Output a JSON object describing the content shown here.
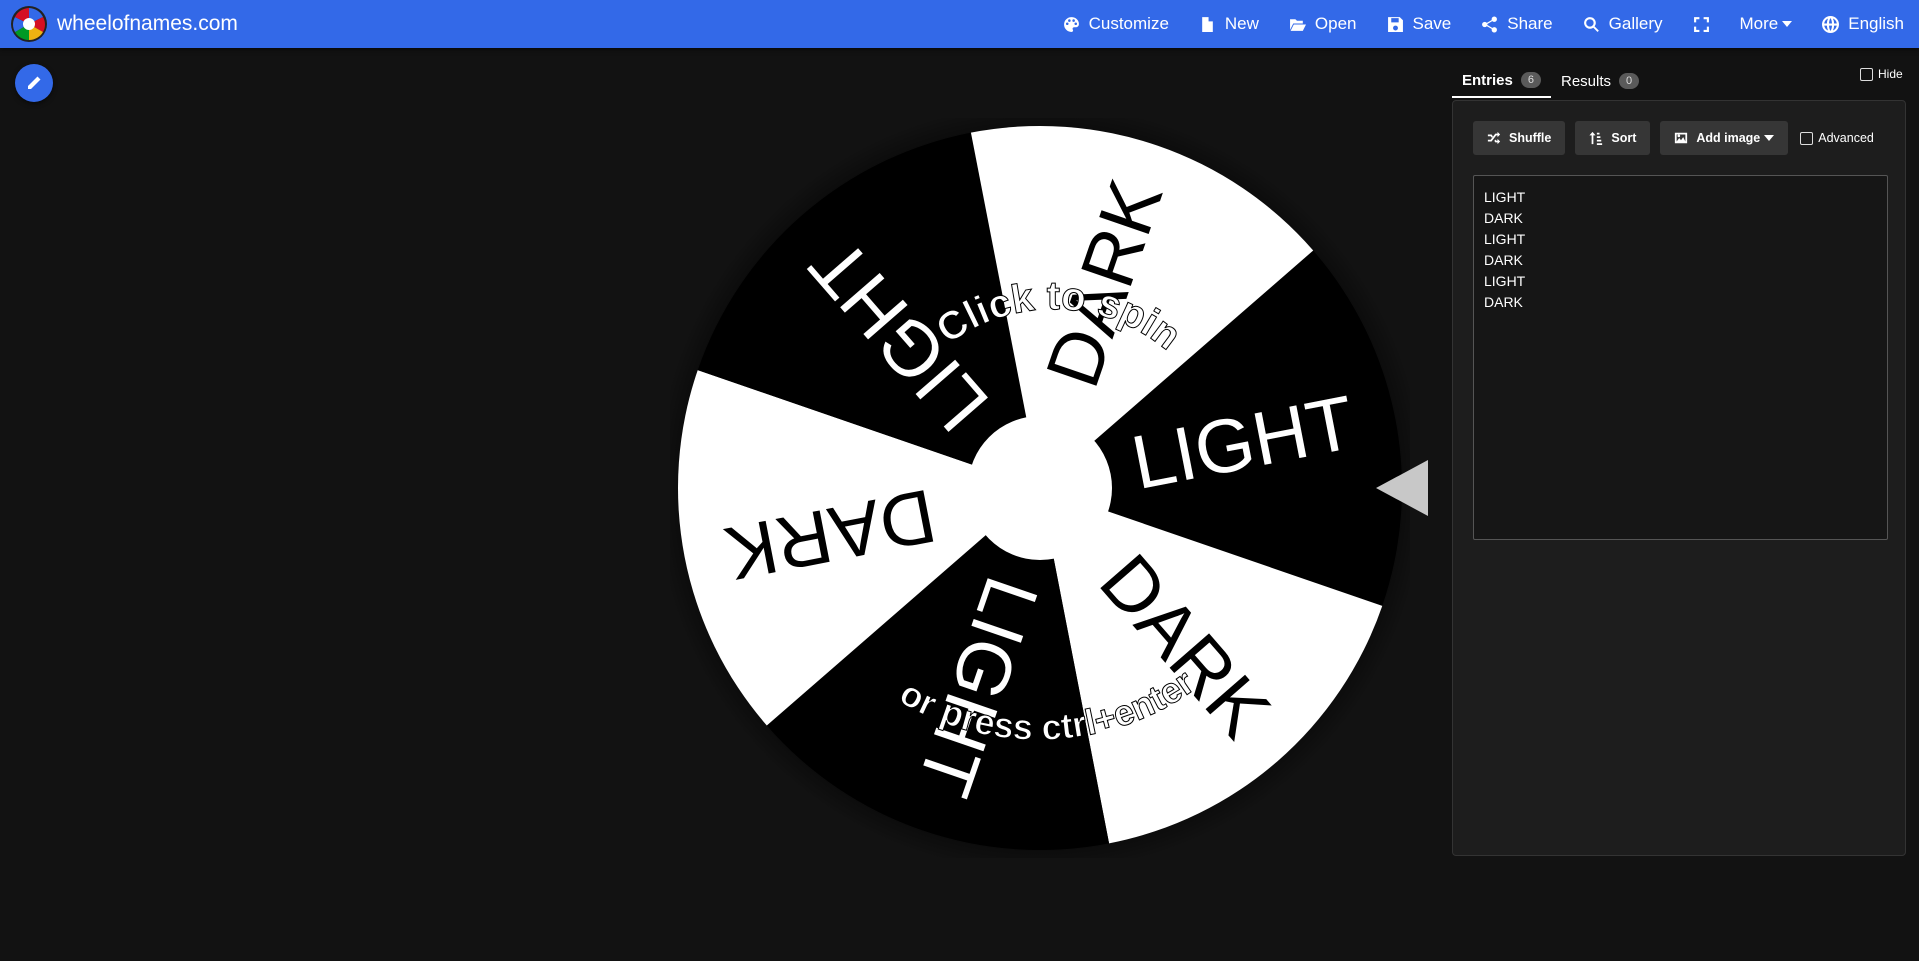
{
  "site": {
    "name": "wheelofnames.com"
  },
  "nav": {
    "customize": "Customize",
    "new": "New",
    "open": "Open",
    "save": "Save",
    "share": "Share",
    "gallery": "Gallery",
    "more": "More",
    "language": "English"
  },
  "wheel": {
    "slices": [
      "LIGHT",
      "DARK",
      "LIGHT",
      "DARK",
      "LIGHT",
      "DARK"
    ],
    "slice_colors": [
      "#ffffff",
      "#000000"
    ],
    "spin_prompt_line1": "Click to spin",
    "spin_prompt_line2": "or press ctrl+enter",
    "pointer_color": "#c8c8c8"
  },
  "panel": {
    "hide_label": "Hide",
    "tabs": [
      {
        "label": "Entries",
        "count": "6"
      },
      {
        "label": "Results",
        "count": "0"
      }
    ],
    "toolbar": {
      "shuffle": "Shuffle",
      "sort": "Sort",
      "add_image": "Add image",
      "advanced": "Advanced"
    },
    "entries": [
      "LIGHT",
      "DARK",
      "LIGHT",
      "DARK",
      "LIGHT",
      "DARK"
    ]
  }
}
